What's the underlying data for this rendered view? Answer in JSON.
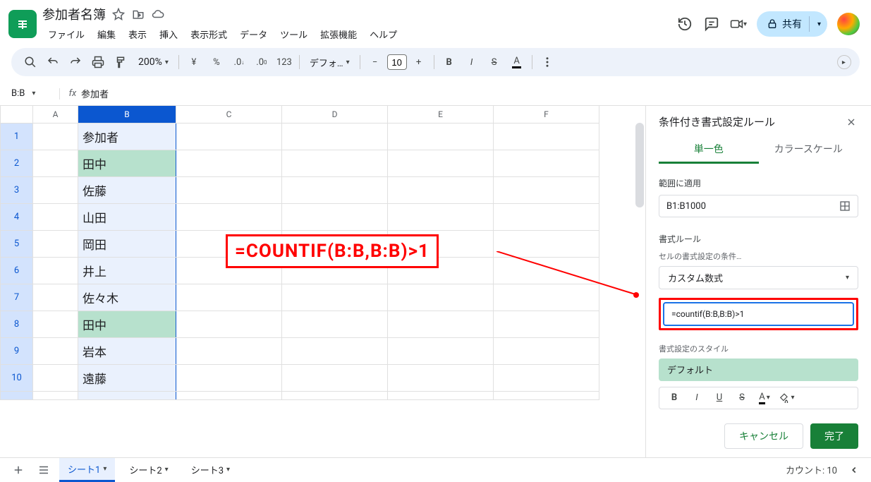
{
  "doc": {
    "title": "参加者名簿"
  },
  "menu": {
    "file": "ファイル",
    "edit": "編集",
    "view": "表示",
    "insert": "挿入",
    "format": "表示形式",
    "data": "データ",
    "tools": "ツール",
    "extensions": "拡張機能",
    "help": "ヘルプ"
  },
  "share": {
    "label": "共有"
  },
  "toolbar": {
    "zoom": "200%",
    "font": "デフォ…",
    "fontsize": "10"
  },
  "namebox": {
    "ref": "B:B"
  },
  "formulabar": {
    "value": "参加者"
  },
  "columns": [
    "A",
    "B",
    "C",
    "D",
    "E",
    "F"
  ],
  "selected_column": "B",
  "rows": [
    {
      "n": "1",
      "b": "参加者",
      "hl": false
    },
    {
      "n": "2",
      "b": "田中",
      "hl": true
    },
    {
      "n": "3",
      "b": "佐藤",
      "hl": false
    },
    {
      "n": "4",
      "b": "山田",
      "hl": false
    },
    {
      "n": "5",
      "b": "岡田",
      "hl": false
    },
    {
      "n": "6",
      "b": "井上",
      "hl": false
    },
    {
      "n": "7",
      "b": "佐々木",
      "hl": false
    },
    {
      "n": "8",
      "b": "田中",
      "hl": true
    },
    {
      "n": "9",
      "b": "岩本",
      "hl": false
    },
    {
      "n": "10",
      "b": "遠藤",
      "hl": false
    }
  ],
  "sidepanel": {
    "title": "条件付き書式設定ルール",
    "tab_single": "単一色",
    "tab_scale": "カラースケール",
    "range_label": "範囲に適用",
    "range_value": "B1:B1000",
    "rule_label": "書式ルール",
    "condition_label": "セルの書式設定の条件…",
    "condition_value": "カスタム数式",
    "formula_value": "=countif(B:B,B:B)>1",
    "style_label": "書式設定のスタイル",
    "style_preview": "デフォルト",
    "cancel": "キャンセル",
    "done": "完了"
  },
  "sheets": {
    "s1": "シート1",
    "s2": "シート2",
    "s3": "シート3"
  },
  "status": {
    "count": "カウント: 10"
  },
  "annotation": {
    "text": "=COUNTIF(B:B,B:B)>1"
  }
}
